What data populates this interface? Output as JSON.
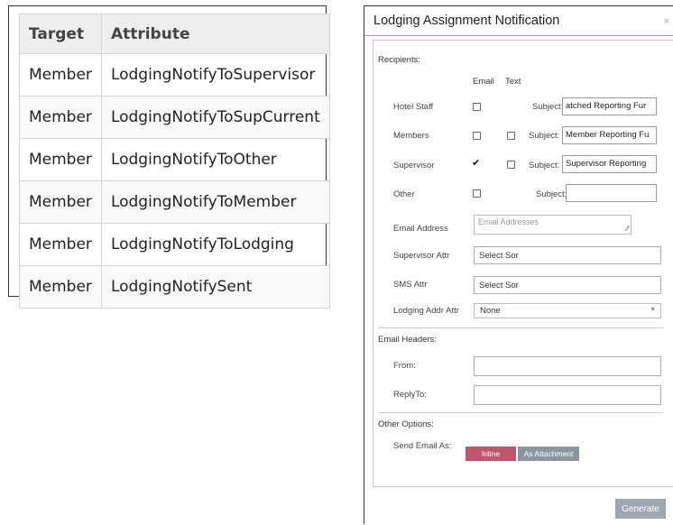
{
  "table": {
    "headers": {
      "target": "Target",
      "attribute": "Attribute"
    },
    "rows": [
      {
        "target": "Member",
        "attribute": "LodgingNotifyToSupervisor"
      },
      {
        "target": "Member",
        "attribute": "LodgingNotifyToSupCurrent"
      },
      {
        "target": "Member",
        "attribute": "LodgingNotifyToOther"
      },
      {
        "target": "Member",
        "attribute": "LodgingNotifyToMember"
      },
      {
        "target": "Member",
        "attribute": "LodgingNotifyToLodging"
      },
      {
        "target": "Member",
        "attribute": "LodgingNotifySent"
      }
    ]
  },
  "modal": {
    "title": "Lodging Assignment Notification",
    "close_icon": "×",
    "recipients_label": "Recipients:",
    "col_email": "Email",
    "col_text": "Text",
    "subject_label": "Subject:",
    "recipients": [
      {
        "label": "Hotel Staff",
        "email_checked": false,
        "has_text": false,
        "text_checked": false,
        "subject": "atched Reporting Fur"
      },
      {
        "label": "Members",
        "email_checked": false,
        "has_text": true,
        "text_checked": false,
        "subject": "Member Reporting Fu"
      },
      {
        "label": "Supervisor",
        "email_checked": true,
        "has_text": true,
        "text_checked": false,
        "subject": "Supervisor Reporting"
      },
      {
        "label": "Other",
        "email_checked": false,
        "has_text": false,
        "text_checked": false,
        "subject": ""
      }
    ],
    "email_address_label": "Email Address",
    "email_address_placeholder": "Email Addresses",
    "supervisor_attr_label": "Supervisor Attr",
    "supervisor_attr_value": "Select Sor",
    "sms_attr_label": "SMS Attr",
    "sms_attr_value": "Select Sor",
    "lodging_addr_label": "Lodging Addr Attr",
    "lodging_addr_value": "None",
    "email_headers_label": "Email Headers:",
    "from_label": "From:",
    "from_value": "",
    "replyto_label": "ReplyTo:",
    "replyto_value": "",
    "other_options_label": "Other Options:",
    "send_as_label": "Send Email As:",
    "inline_html_label": "Inline HTML",
    "attachment_label": "As Attachment",
    "generate_label": "Generate"
  },
  "colors": {
    "accent": "#c0566b",
    "secondary_button": "#8d96a0",
    "generate_button": "#a0a6ad",
    "header_rule": "#d98a97"
  }
}
